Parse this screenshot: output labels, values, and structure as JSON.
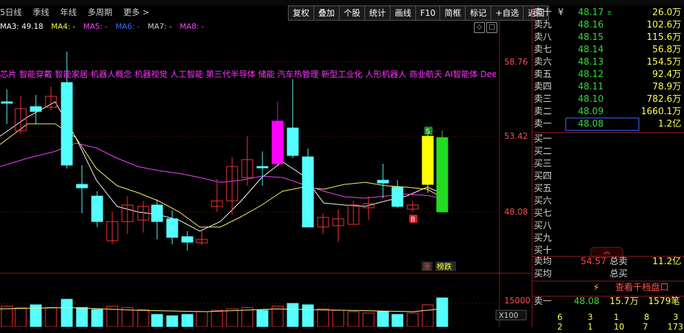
{
  "period_tabs": [
    "5日线",
    "季线",
    "年线",
    "多周期",
    "更多"
  ],
  "more_chevron": ">",
  "toolbar": [
    "复权",
    "叠加",
    "个股",
    "统计",
    "画线",
    "F10",
    "简框",
    "标记",
    "+自选",
    "返回"
  ],
  "ma_legend": [
    {
      "label": "MA3: 49.18",
      "color": "#ffffff"
    },
    {
      "label": "MA4: -",
      "color": "#ffff44"
    },
    {
      "label": "MA5: -",
      "color": "#ff44ff"
    },
    {
      "label": "MA6: -",
      "color": "#3a6cff"
    },
    {
      "label": "MA7: -",
      "color": "#cccccc"
    },
    {
      "label": "MA8: -",
      "color": "#ff44ff"
    }
  ],
  "concepts": "芯片 智能穿戴 智能家居 机器人概念 机器视觉 人工智能 第三代半导体 储能 汽车热管理 新型工业化 人形机器人 商业航天 AI智能体 Deep",
  "price_axis": [
    "58.76",
    "53.42",
    "48.08"
  ],
  "volume_axis": "15000",
  "volume_unit": "X100",
  "markers": {
    "s": "S",
    "b": "B",
    "zhang": "涨",
    "bangdie": "榜跌"
  },
  "orderbook_asks": [
    {
      "label": "卖十",
      "mark": "¥",
      "price": "48.17",
      "tag": "±",
      "vol": "26.0万"
    },
    {
      "label": "卖九",
      "price": "48.16",
      "vol": "102.6万"
    },
    {
      "label": "卖八",
      "price": "48.15",
      "vol": "115.6万"
    },
    {
      "label": "卖七",
      "price": "48.14",
      "vol": "56.8万"
    },
    {
      "label": "卖六",
      "price": "48.13",
      "vol": "154.5万"
    },
    {
      "label": "卖五",
      "price": "48.12",
      "vol": "92.4万"
    },
    {
      "label": "卖四",
      "price": "48.11",
      "vol": "78.9万"
    },
    {
      "label": "卖三",
      "price": "48.10",
      "vol": "782.6万"
    },
    {
      "label": "卖二",
      "price": "48.09",
      "vol": "1660.1万"
    },
    {
      "label": "卖一",
      "price": "48.08",
      "vol": "1.2亿"
    }
  ],
  "orderbook_bids": [
    "买一",
    "买二",
    "买三",
    "买四",
    "买五",
    "买六",
    "买七",
    "买八",
    "买九",
    "买十"
  ],
  "avg": {
    "sell_avg_label": "卖均",
    "sell_avg": "54.57",
    "total_sell_label": "总卖",
    "total_sell": "11.2亿",
    "buy_avg_label": "买均",
    "total_buy_label": "总买"
  },
  "thousand_levels": "查看千档盘口",
  "trade": {
    "label": "卖一",
    "price": "48.08",
    "vol": "15.7万",
    "unit": "笔",
    "count": "1579笔"
  },
  "bottom_row1": [
    "6",
    "3",
    "1",
    "8",
    "3"
  ],
  "bottom_row2": [
    "2",
    "1",
    "10",
    "7",
    "173"
  ],
  "colors": {
    "up": "#ff3333",
    "down": "#55ffff",
    "grid": "#7a1010",
    "bid_green": "#33dd33"
  }
}
